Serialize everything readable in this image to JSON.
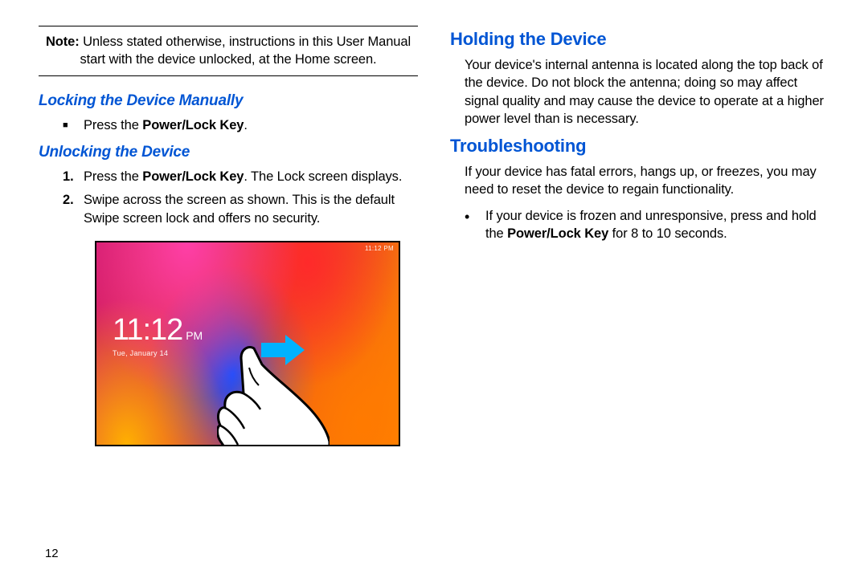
{
  "left": {
    "note_label": "Note:",
    "note_text": " Unless stated otherwise, instructions in this User Manual start with the device unlocked, at the Home screen.",
    "h_locking": "Locking the Device Manually",
    "lock_step_pre": "Press the ",
    "lock_step_bold": "Power/Lock Key",
    "lock_step_post": ".",
    "h_unlocking": "Unlocking the Device",
    "unlock1_pre": "Press the ",
    "unlock1_bold": "Power/Lock Key",
    "unlock1_post": ". The Lock screen displays.",
    "unlock2": "Swipe across the screen as shown. This is the default Swipe screen lock and offers no security.",
    "lockscreen_time": "11:12",
    "lockscreen_ampm": "PM",
    "lockscreen_date": "Tue, January 14",
    "lockscreen_status": "11:12 PM",
    "page_number": "12"
  },
  "right": {
    "h_holding": "Holding the Device",
    "holding_text": "Your device's internal antenna is located along the top back of the device. Do not block the antenna; doing so may affect signal quality and may cause the device to operate at a higher power level than is necessary.",
    "h_trouble": "Troubleshooting",
    "trouble_intro": "If your device has fatal errors, hangs up, or freezes, you may need to reset the device to regain functionality.",
    "trouble_bullet_pre": "If your device is frozen and unresponsive, press and hold the ",
    "trouble_bullet_bold": "Power/Lock Key",
    "trouble_bullet_post": " for 8 to 10 seconds."
  }
}
